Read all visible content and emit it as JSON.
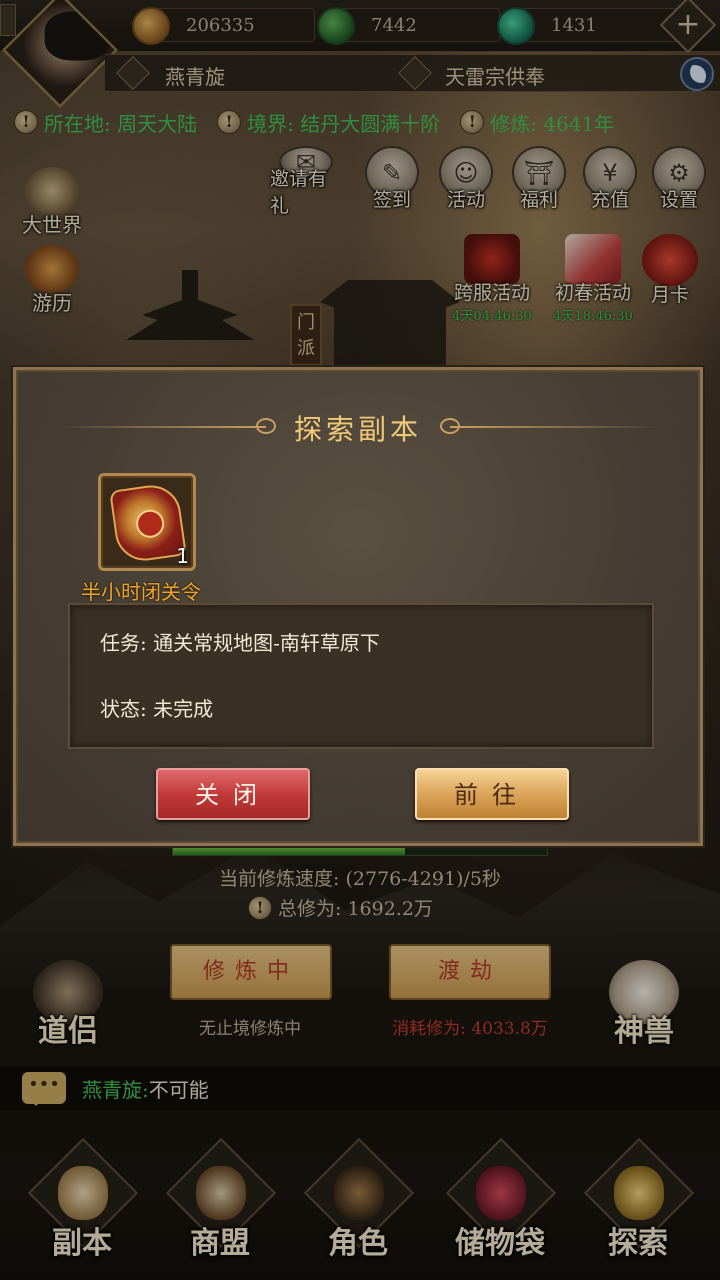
{
  "resources": {
    "gold": "206335",
    "jade": "7442",
    "spirit": "1431"
  },
  "player": {
    "name": "燕青旋",
    "sect_title": "天雷宗供奉"
  },
  "status": {
    "location": "所在地: 周天大陆",
    "realm": "境界: 结丹大圆满十阶",
    "cultivation": "修炼: 4641年"
  },
  "left_menu": [
    {
      "label": "大世界",
      "icon": "scroll-icon"
    },
    {
      "label": "游历",
      "icon": "gourd-icon"
    }
  ],
  "top_menu": [
    {
      "label": "邀请有礼",
      "icon": "mail-icon"
    },
    {
      "label": "签到",
      "icon": "brush-icon"
    },
    {
      "label": "活动",
      "icon": "mask-icon"
    },
    {
      "label": "福利",
      "icon": "gate-icon"
    },
    {
      "label": "充值",
      "icon": "money-bag-icon"
    },
    {
      "label": "设置",
      "icon": "gear-icon"
    }
  ],
  "events": [
    {
      "label": "跨服活动",
      "time": "4天04:46:30"
    },
    {
      "label": "初春活动",
      "time": "4天18:46:30"
    },
    {
      "label": "月卡",
      "time": ""
    }
  ],
  "sect_sign": "门派",
  "dialog": {
    "title": "探索副本",
    "item": {
      "name": "半小时闭关令",
      "count": "1"
    },
    "task": "任务: 通关常规地图-南轩草原下",
    "state": "状态: 未完成",
    "close_label": "关闭",
    "go_label": "前往"
  },
  "cultivate": {
    "progress": 0.62,
    "speed": "当前修炼速度: (2776-4291)/5秒",
    "total": "总修为: 1692.2万",
    "practice_label": "修炼中",
    "practice_sub": "无止境修炼中",
    "tribulation_label": "渡劫",
    "tribulation_sub": "消耗修为: 4033.8万",
    "partner_label": "道侣",
    "beast_label": "神兽"
  },
  "chat": {
    "name": "燕青旋:",
    "message": " 不可能"
  },
  "nav": [
    {
      "label": "副本",
      "icon": "map-scroll-icon"
    },
    {
      "label": "商盟",
      "icon": "shop-icon"
    },
    {
      "label": "角色",
      "icon": "helmet-icon"
    },
    {
      "label": "储物袋",
      "icon": "bag-icon"
    },
    {
      "label": "探索",
      "icon": "compass-icon"
    }
  ],
  "colors": {
    "green_text": "#3fbf55",
    "gold_title": "#f0c978",
    "item_orange": "#f0a526",
    "red_button": "#c23a3a",
    "gold_button": "#dba45a"
  }
}
